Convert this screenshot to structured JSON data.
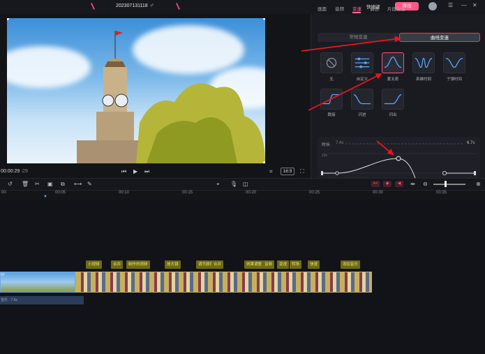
{
  "app": {
    "title": "20230713111​8",
    "edit_mark": "✐",
    "shortcut_label": "快捷键",
    "export_label": "导出"
  },
  "preview": {
    "timecode_current": "00:00:29",
    "timecode_frames": ":29",
    "ratio_label": "16:9"
  },
  "panel": {
    "tabs": [
      "画面",
      "音频",
      "变速",
      "调色",
      "片段信息"
    ],
    "active_tab": 2,
    "segment": {
      "left_label": "常规变速",
      "right_label": "曲线变速",
      "active": "right"
    },
    "curves": [
      {
        "label": "无",
        "icon": "none-icon"
      },
      {
        "label": "自定义",
        "icon": "custom-icon"
      },
      {
        "label": "蒙太奇",
        "icon": "montage-icon",
        "selected": true
      },
      {
        "label": "英雄时刻",
        "icon": "hero-icon"
      },
      {
        "label": "子弹时间",
        "icon": "bullet-icon"
      },
      {
        "label": "跳接",
        "icon": "jump-icon"
      },
      {
        "label": "闪进",
        "icon": "flash-in-icon"
      },
      {
        "label": "闪出",
        "icon": "flash-out-icon"
      }
    ],
    "duration_label": "时长",
    "duration_min": "7.4s",
    "duration_max": "6.7s",
    "graph_ylabel": "10x"
  },
  "timeline": {
    "ticks": [
      "00",
      "00:05",
      "00:10",
      "00:15",
      "00:20",
      "00:25",
      "00:30",
      "00:35"
    ],
    "tags": [
      "小视频",
      "合并",
      "制作的视频",
      "放大镜",
      "调节颜色",
      "合并",
      "效果调整",
      "音频",
      "变速",
      "转场",
      "快速",
      "添加音乐",
      "音频剪辑",
      "更多"
    ],
    "clip_time": "07",
    "audio_text": "音乐 · 7.5s"
  },
  "colors": {
    "accent": "#ff5a8a",
    "arrow": "#e8141f",
    "selection": "#ff4d7a"
  }
}
